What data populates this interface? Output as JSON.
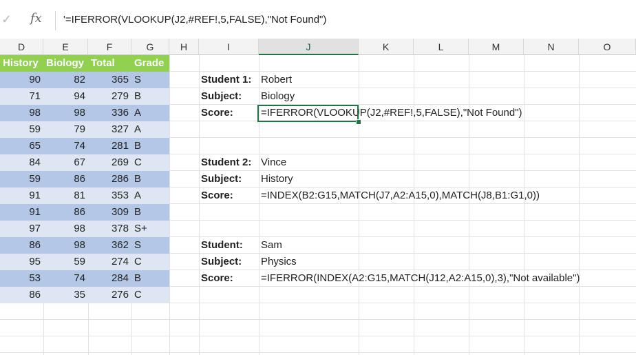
{
  "formula_bar": {
    "cancel_icon": "check-icon",
    "fx_label": "fx",
    "formula": "'=IFERROR(VLOOKUP(J2,#REF!,5,FALSE),\"Not Found\")"
  },
  "columns": [
    "D",
    "E",
    "F",
    "G",
    "H",
    "I",
    "J",
    "K",
    "L",
    "M",
    "N",
    "O"
  ],
  "selected_column": "J",
  "table": {
    "headers": [
      "History",
      "Biology",
      "Total",
      "Grade"
    ],
    "rows": [
      [
        "90",
        "82",
        "365",
        "S"
      ],
      [
        "71",
        "94",
        "279",
        "B"
      ],
      [
        "98",
        "98",
        "336",
        "A"
      ],
      [
        "59",
        "79",
        "327",
        "A"
      ],
      [
        "65",
        "74",
        "281",
        "B"
      ],
      [
        "84",
        "67",
        "269",
        "C"
      ],
      [
        "59",
        "86",
        "286",
        "B"
      ],
      [
        "91",
        "81",
        "353",
        "A"
      ],
      [
        "91",
        "86",
        "309",
        "B"
      ],
      [
        "97",
        "98",
        "378",
        "S+"
      ],
      [
        "86",
        "98",
        "362",
        "S"
      ],
      [
        "95",
        "59",
        "274",
        "C"
      ],
      [
        "53",
        "74",
        "284",
        "B"
      ],
      [
        "86",
        "35",
        "276",
        "C"
      ]
    ]
  },
  "lookups": [
    {
      "student_label": "Student 1:",
      "student": "Robert",
      "subject_label": "Subject:",
      "subject": "Biology",
      "score_label": "Score:",
      "score": "=IFERROR(VLOOKUP(J2,#REF!,5,FALSE),\"Not Found\")"
    },
    {
      "student_label": "Student 2:",
      "student": "Vince",
      "subject_label": "Subject:",
      "subject": "History",
      "score_label": "Score:",
      "score": "=INDEX(B2:G15,MATCH(J7,A2:A15,0),MATCH(J8,B1:G1,0))"
    },
    {
      "student_label": "Student:",
      "student": "Sam",
      "subject_label": "Subject:",
      "subject": "Physics",
      "score_label": "Score:",
      "score": "=IFERROR(INDEX(A2:G15,MATCH(J12,A2:A15,0),3),\"Not available\")"
    }
  ],
  "colors": {
    "header_green": "#92d050",
    "band_blue": "#b4c7e7",
    "light_blue": "#dde6f2",
    "excel_green": "#217346"
  }
}
